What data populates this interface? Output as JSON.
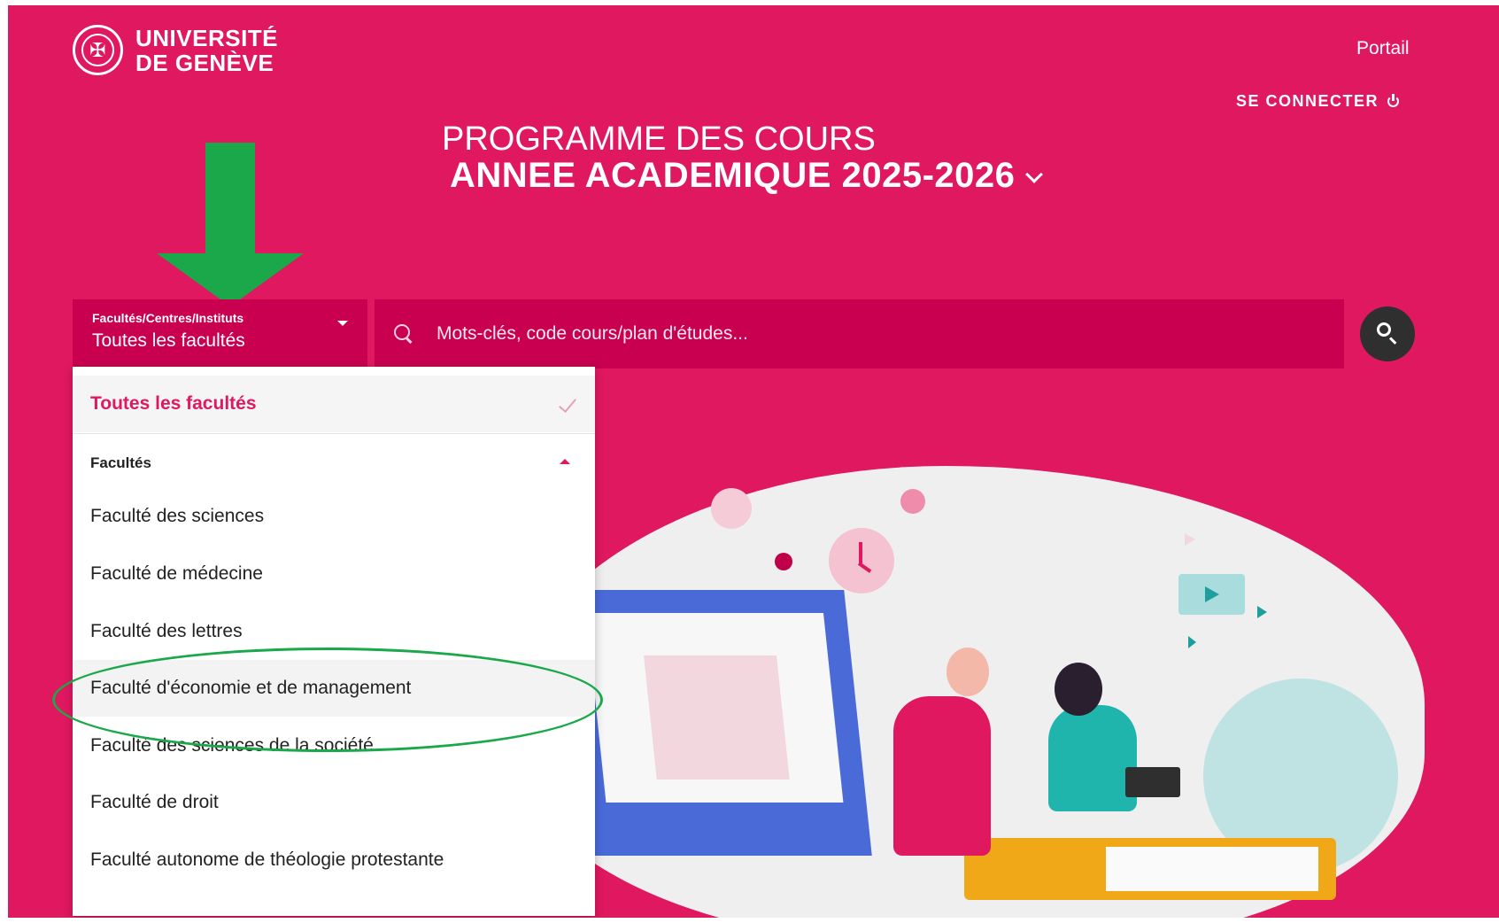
{
  "header": {
    "logo_line1": "UNIVERSITÉ",
    "logo_line2": "DE GENÈVE",
    "portal_label": "Portail",
    "connect_label": "SE CONNECTER"
  },
  "hero": {
    "title_line1": "PROGRAMME DES COURS",
    "title_line2": "ANNEE ACADEMIQUE 2025-2026"
  },
  "search": {
    "faculty_label": "Facultés/Centres/Instituts",
    "faculty_value": "Toutes les facultés",
    "placeholder": "Mots-clés, code cours/plan d'études..."
  },
  "dropdown": {
    "selected": "Toutes les facultés",
    "group_label": "Facultés",
    "items": [
      "Faculté des sciences",
      "Faculté de médecine",
      "Faculté des lettres",
      "Faculté d'économie et de management",
      "Faculté des sciences de la société",
      "Faculté de droit",
      "Faculté autonome de théologie protestante"
    ]
  },
  "colors": {
    "brand": "#e0185f",
    "field": "#c8004f",
    "annotation": "#1aa84a"
  }
}
